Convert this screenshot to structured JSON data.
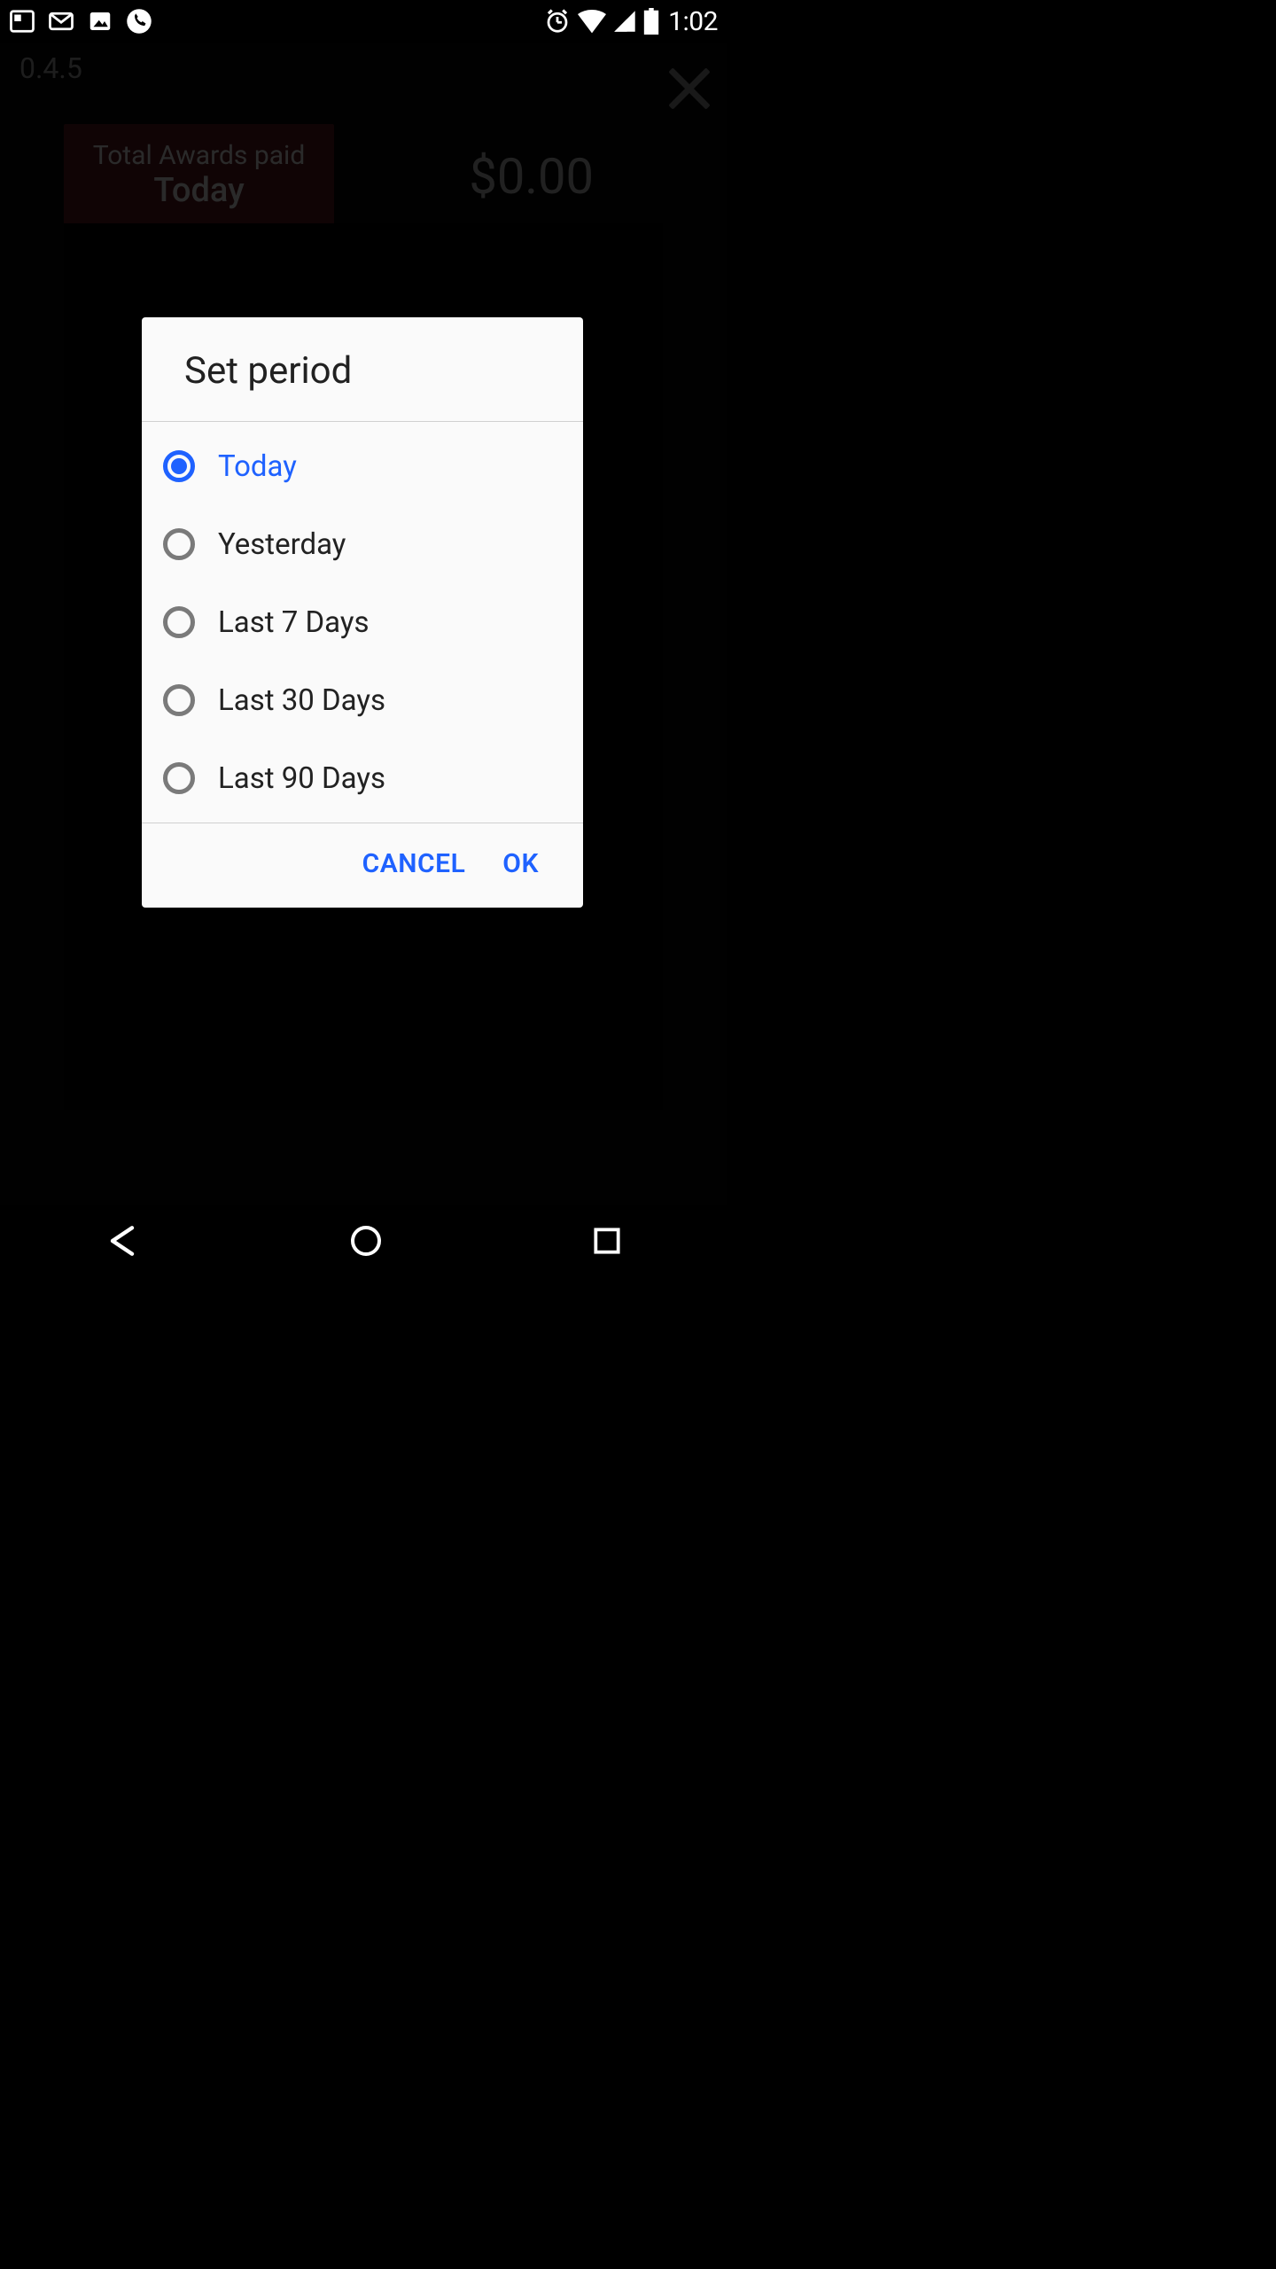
{
  "status": {
    "clock": "1:02"
  },
  "app": {
    "version": "0.4.5",
    "summary_label_line1": "Total Awards paid",
    "summary_label_line2": "Today",
    "amount": "$0.00"
  },
  "dialog": {
    "title": "Set period",
    "options": [
      {
        "label": "Today",
        "selected": true
      },
      {
        "label": "Yesterday",
        "selected": false
      },
      {
        "label": "Last 7 Days",
        "selected": false
      },
      {
        "label": "Last 30 Days",
        "selected": false
      },
      {
        "label": "Last 90 Days",
        "selected": false
      }
    ],
    "cancel": "CANCEL",
    "ok": "OK"
  },
  "colors": {
    "accent": "#1f62ff",
    "accent_dark": "#5b1a1f"
  }
}
